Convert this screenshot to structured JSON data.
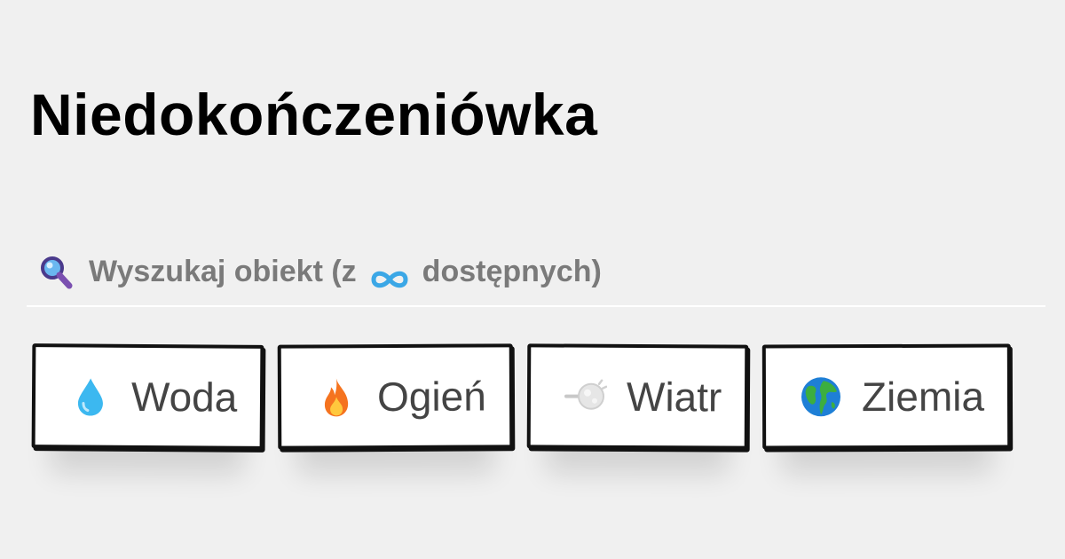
{
  "page": {
    "title": "Niedokończeniówka"
  },
  "search": {
    "placeholder_prefix": "Wyszukaj obiekt (z",
    "placeholder_suffix": "dostępnych)",
    "icon": "magnifying-glass-icon",
    "count_icon": "infinity-icon",
    "value": ""
  },
  "items": [
    {
      "label": "Woda",
      "icon": "water-drop-icon"
    },
    {
      "label": "Ogień",
      "icon": "fire-icon"
    },
    {
      "label": "Wiatr",
      "icon": "wind-icon"
    },
    {
      "label": "Ziemia",
      "icon": "earth-globe-icon"
    }
  ],
  "colors": {
    "background": "#f0f0f0",
    "text": "#000000",
    "muted": "#7a7a7a",
    "accent": "#3ba7e6"
  }
}
